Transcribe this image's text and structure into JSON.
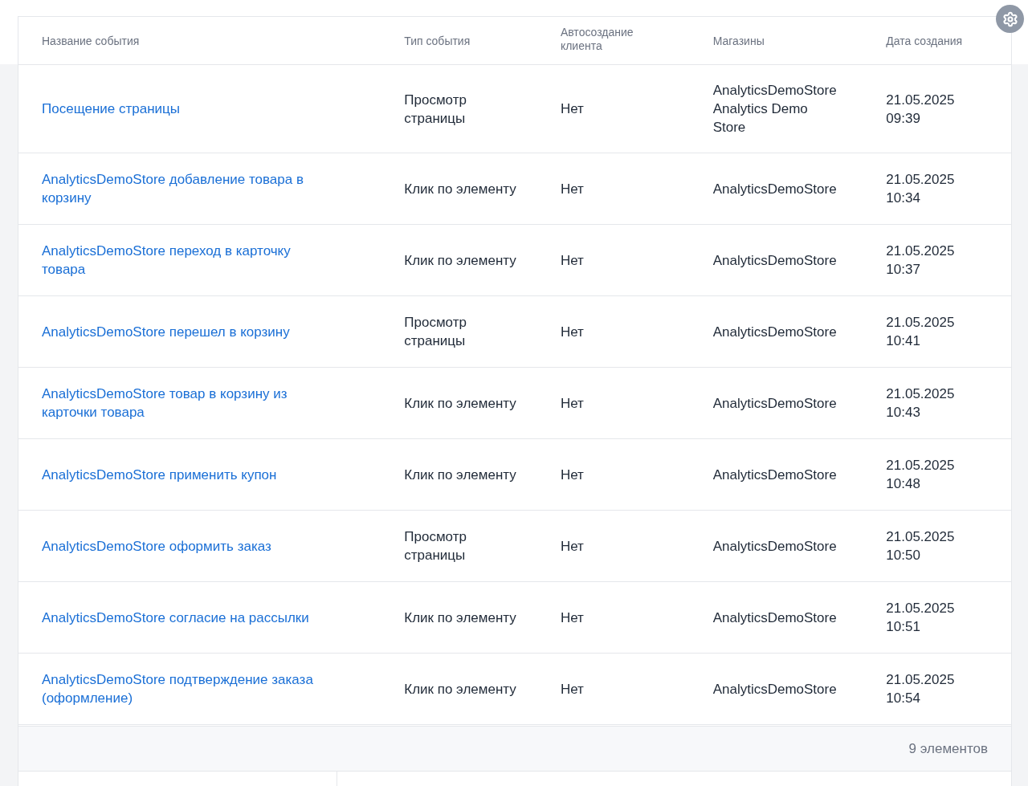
{
  "table": {
    "columns": [
      "Название события",
      "Тип события",
      "Автосоздание клиента",
      "Магазины",
      "Дата создания"
    ],
    "rows": [
      {
        "name": "Посещение страницы",
        "type": "Просмотр страницы",
        "autocreate": "Нет",
        "stores": [
          "AnalyticsDemoStore",
          "Analytics Demo Store"
        ],
        "date": "21.05.2025",
        "time": "09:39"
      },
      {
        "name": "AnalyticsDemoStore добавление товара в корзину",
        "type": "Клик по элементу",
        "autocreate": "Нет",
        "stores": [
          "AnalyticsDemoStore"
        ],
        "date": "21.05.2025",
        "time": "10:34"
      },
      {
        "name": "AnalyticsDemoStore переход в карточку товара",
        "type": "Клик по элементу",
        "autocreate": "Нет",
        "stores": [
          "AnalyticsDemoStore"
        ],
        "date": "21.05.2025",
        "time": "10:37"
      },
      {
        "name": "AnalyticsDemoStore перешел в корзину",
        "type": "Просмотр страницы",
        "autocreate": "Нет",
        "stores": [
          "AnalyticsDemoStore"
        ],
        "date": "21.05.2025",
        "time": "10:41"
      },
      {
        "name": "AnalyticsDemoStore товар в корзину из карточки товара",
        "type": "Клик по элементу",
        "autocreate": "Нет",
        "stores": [
          "AnalyticsDemoStore"
        ],
        "date": "21.05.2025",
        "time": "10:43"
      },
      {
        "name": "AnalyticsDemoStore применить купон",
        "type": "Клик по элементу",
        "autocreate": "Нет",
        "stores": [
          "AnalyticsDemoStore"
        ],
        "date": "21.05.2025",
        "time": "10:48"
      },
      {
        "name": "AnalyticsDemoStore оформить заказ",
        "type": "Просмотр страницы",
        "autocreate": "Нет",
        "stores": [
          "AnalyticsDemoStore"
        ],
        "date": "21.05.2025",
        "time": "10:50"
      },
      {
        "name": "AnalyticsDemoStore согласие на рассылки",
        "type": "Клик по элементу",
        "autocreate": "Нет",
        "stores": [
          "AnalyticsDemoStore"
        ],
        "date": "21.05.2025",
        "time": "10:51"
      },
      {
        "name": "AnalyticsDemoStore подтверждение заказа (оформление)",
        "type": "Клик по элементу",
        "autocreate": "Нет",
        "stores": [
          "AnalyticsDemoStore"
        ],
        "date": "21.05.2025",
        "time": "10:54"
      }
    ],
    "footer": "9 элементов"
  }
}
